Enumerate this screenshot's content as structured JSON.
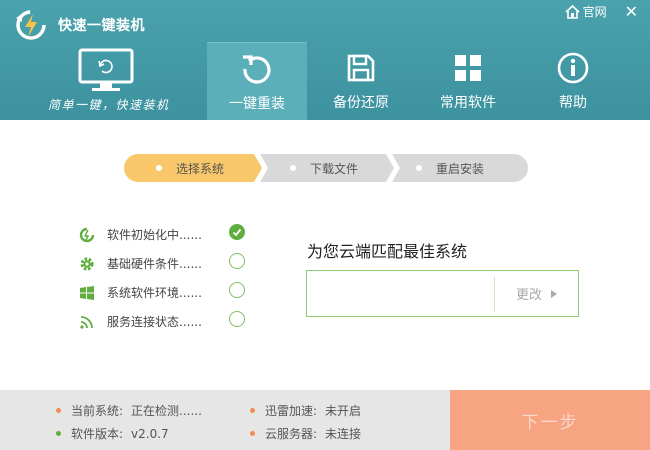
{
  "header": {
    "app_title": "快速一键装机",
    "slogan": "简单一键，快速装机",
    "home_link": "官网",
    "close": "✕",
    "tabs": [
      {
        "label": "一键重装",
        "active": true
      },
      {
        "label": "备份还原",
        "active": false
      },
      {
        "label": "常用软件",
        "active": false
      },
      {
        "label": "帮助",
        "active": false
      }
    ]
  },
  "steps": [
    {
      "label": "选择系统",
      "active": true
    },
    {
      "label": "下载文件",
      "active": false
    },
    {
      "label": "重启安装",
      "active": false
    }
  ],
  "checklist": [
    {
      "label": "软件初始化中......",
      "done": true
    },
    {
      "label": "基础硬件条件......",
      "done": false
    },
    {
      "label": "系统软件环境......",
      "done": false
    },
    {
      "label": "服务连接状态......",
      "done": false
    }
  ],
  "match": {
    "title": "为您云端匹配最佳系统",
    "value": "",
    "change_label": "更改"
  },
  "footer": {
    "current_system": {
      "label": "当前系统:",
      "value": "正在检测......"
    },
    "version": {
      "label": "软件版本:",
      "value": "v2.0.7"
    },
    "thunder": {
      "label": "迅雷加速:",
      "value": "未开启"
    },
    "cloud": {
      "label": "云服务器:",
      "value": "未连接"
    },
    "next_label": "下一步"
  },
  "colors": {
    "header_bg": "#3f96a2",
    "active_tab": "#5aafb9",
    "step_active": "#f8c86a",
    "step_inactive": "#d9d9d9",
    "check_green": "#5fae3f",
    "next_button": "#f6a482",
    "bullet_orange": "#f08b55",
    "bullet_green": "#5fae3f"
  }
}
